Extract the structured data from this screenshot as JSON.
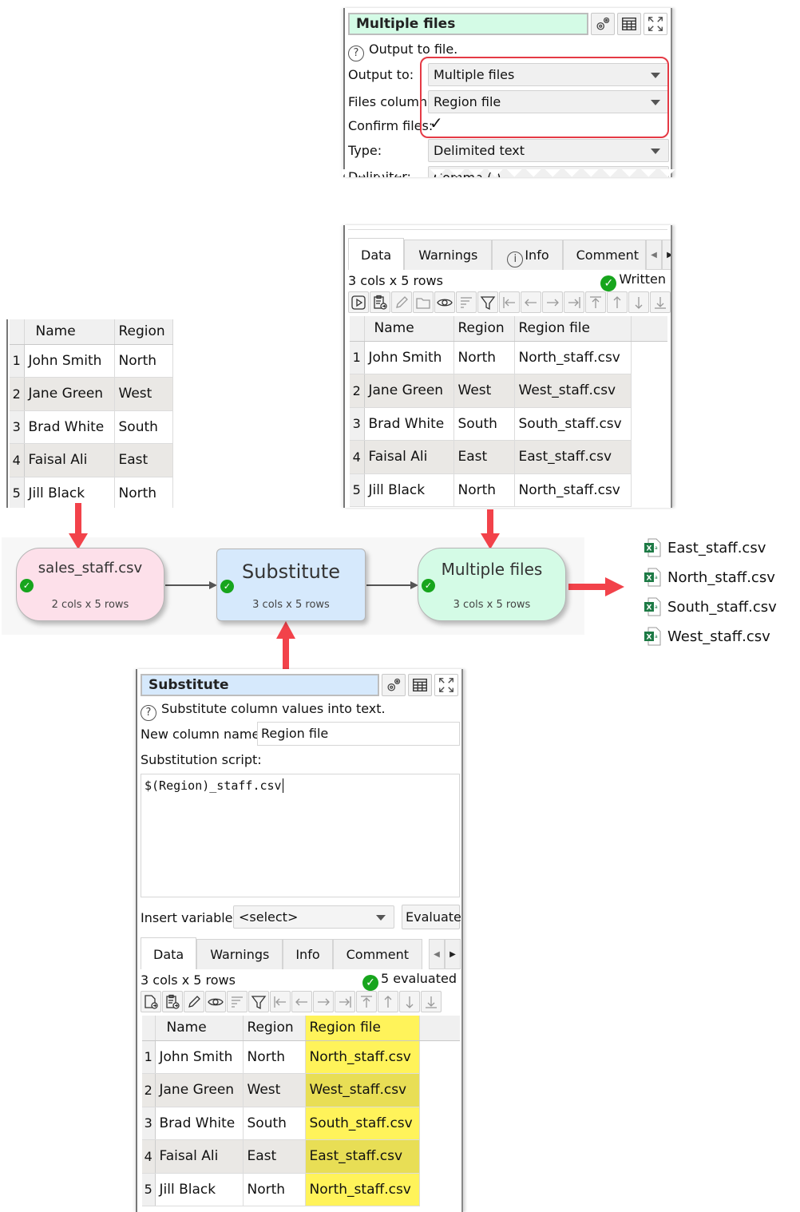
{
  "colors": {
    "arrow_red": "#f2424a",
    "source_node": "#fde0ea",
    "transform_node": "#d6e9fc",
    "output_node": "#d4fbe6",
    "highlight_yellow": "#fff35a",
    "status_green": "#17a51d"
  },
  "output_panel": {
    "title": "Multiple files",
    "icons": [
      "gears-icon",
      "table-icon",
      "maximize-icon"
    ],
    "help_text": "Output to file.",
    "fields": {
      "output_to_label": "Output to:",
      "output_to_value": "Multiple files",
      "files_column_label": "Files column:",
      "files_column_value": "Region file",
      "confirm_files_label": "Confirm files:",
      "confirm_files_checked": true,
      "confirm_files_mark": "✓",
      "type_label": "Type:",
      "type_value": "Delimited text",
      "delimiter_label": "Delimiter:",
      "delimiter_value": "Comma (,)"
    }
  },
  "output_data_panel": {
    "tabs": [
      "Data",
      "Warnings",
      "Info",
      "Comment"
    ],
    "active_tab": "Data",
    "summary": "3 cols x 5 rows",
    "status": "Written",
    "columns": [
      "Name",
      "Region",
      "Region file"
    ],
    "rows": [
      {
        "n": "1",
        "name": "John Smith",
        "region": "North",
        "file": "North_staff.csv"
      },
      {
        "n": "2",
        "name": "Jane Green",
        "region": "West",
        "file": "West_staff.csv"
      },
      {
        "n": "3",
        "name": "Brad White",
        "region": "South",
        "file": "South_staff.csv"
      },
      {
        "n": "4",
        "name": "Faisal Ali",
        "region": "East",
        "file": "East_staff.csv"
      },
      {
        "n": "5",
        "name": "Jill Black",
        "region": "North",
        "file": "North_staff.csv"
      }
    ]
  },
  "input_table": {
    "columns": [
      "Name",
      "Region"
    ],
    "rows": [
      {
        "n": "1",
        "name": "John Smith",
        "region": "North"
      },
      {
        "n": "2",
        "name": "Jane Green",
        "region": "West"
      },
      {
        "n": "3",
        "name": "Brad White",
        "region": "South"
      },
      {
        "n": "4",
        "name": "Faisal Ali",
        "region": "East"
      },
      {
        "n": "5",
        "name": "Jill Black",
        "region": "North"
      }
    ]
  },
  "flow": {
    "nodes": [
      {
        "title": "sales_staff.csv",
        "subtitle": "2 cols x 5 rows"
      },
      {
        "title": "Substitute",
        "subtitle": "3 cols x 5 rows"
      },
      {
        "title": "Multiple files",
        "subtitle": "3 cols x 5 rows"
      }
    ],
    "output_files": [
      "East_staff.csv",
      "North_staff.csv",
      "South_staff.csv",
      "West_staff.csv"
    ]
  },
  "substitute_panel": {
    "title": "Substitute",
    "help_text": "Substitute column values into text.",
    "new_column_label": "New column name:",
    "new_column_value": "Region file",
    "script_label": "Substitution script:",
    "script_value": "$(Region)_staff.csv",
    "insert_variable_label": "Insert variable:",
    "insert_variable_value": "<select>",
    "evaluate_label": "Evaluate",
    "tabs": [
      "Data",
      "Warnings",
      "Info",
      "Comment"
    ],
    "active_tab": "Data",
    "summary": "3 cols x 5 rows",
    "status": "5 evaluated",
    "columns": [
      "Name",
      "Region",
      "Region file"
    ],
    "rows": [
      {
        "n": "1",
        "name": "John Smith",
        "region": "North",
        "file": "North_staff.csv"
      },
      {
        "n": "2",
        "name": "Jane Green",
        "region": "West",
        "file": "West_staff.csv"
      },
      {
        "n": "3",
        "name": "Brad White",
        "region": "South",
        "file": "South_staff.csv"
      },
      {
        "n": "4",
        "name": "Faisal Ali",
        "region": "East",
        "file": "East_staff.csv"
      },
      {
        "n": "5",
        "name": "Jill Black",
        "region": "North",
        "file": "North_staff.csv"
      }
    ]
  }
}
